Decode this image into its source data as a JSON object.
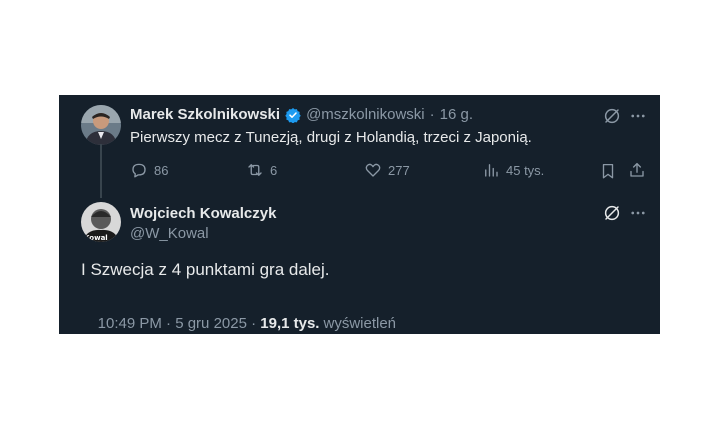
{
  "quoted": {
    "author_name": "Marek Szkolnikowski",
    "handle": "@mszkolnikowski",
    "sep": "·",
    "time": "16 g.",
    "text": "Pierwszy mecz z Tunezją, drugi z Holandią, trzeci z Japonią.",
    "replies": "86",
    "reposts": "6",
    "likes": "277",
    "views": "45 tys."
  },
  "reply": {
    "author_name": "Wojciech Kowalczyk",
    "handle": "@W_Kowal",
    "text": "I Szwecja z 4 punktami gra dalej.",
    "timestamp": "10:49 PM · 5 gru 2025 · ",
    "views_count": "19,1 tys.",
    "views_label": "wyświetleń",
    "avatar_caption": "Kowal"
  },
  "colors": {
    "background": "#15202b",
    "verified": "#1d9bf0",
    "muted": "#8b98a5"
  },
  "icons": [
    "verified-badge-icon",
    "grok-icon",
    "more-icon",
    "reply-icon",
    "repost-icon",
    "like-icon",
    "views-icon",
    "bookmark-icon",
    "share-icon"
  ]
}
